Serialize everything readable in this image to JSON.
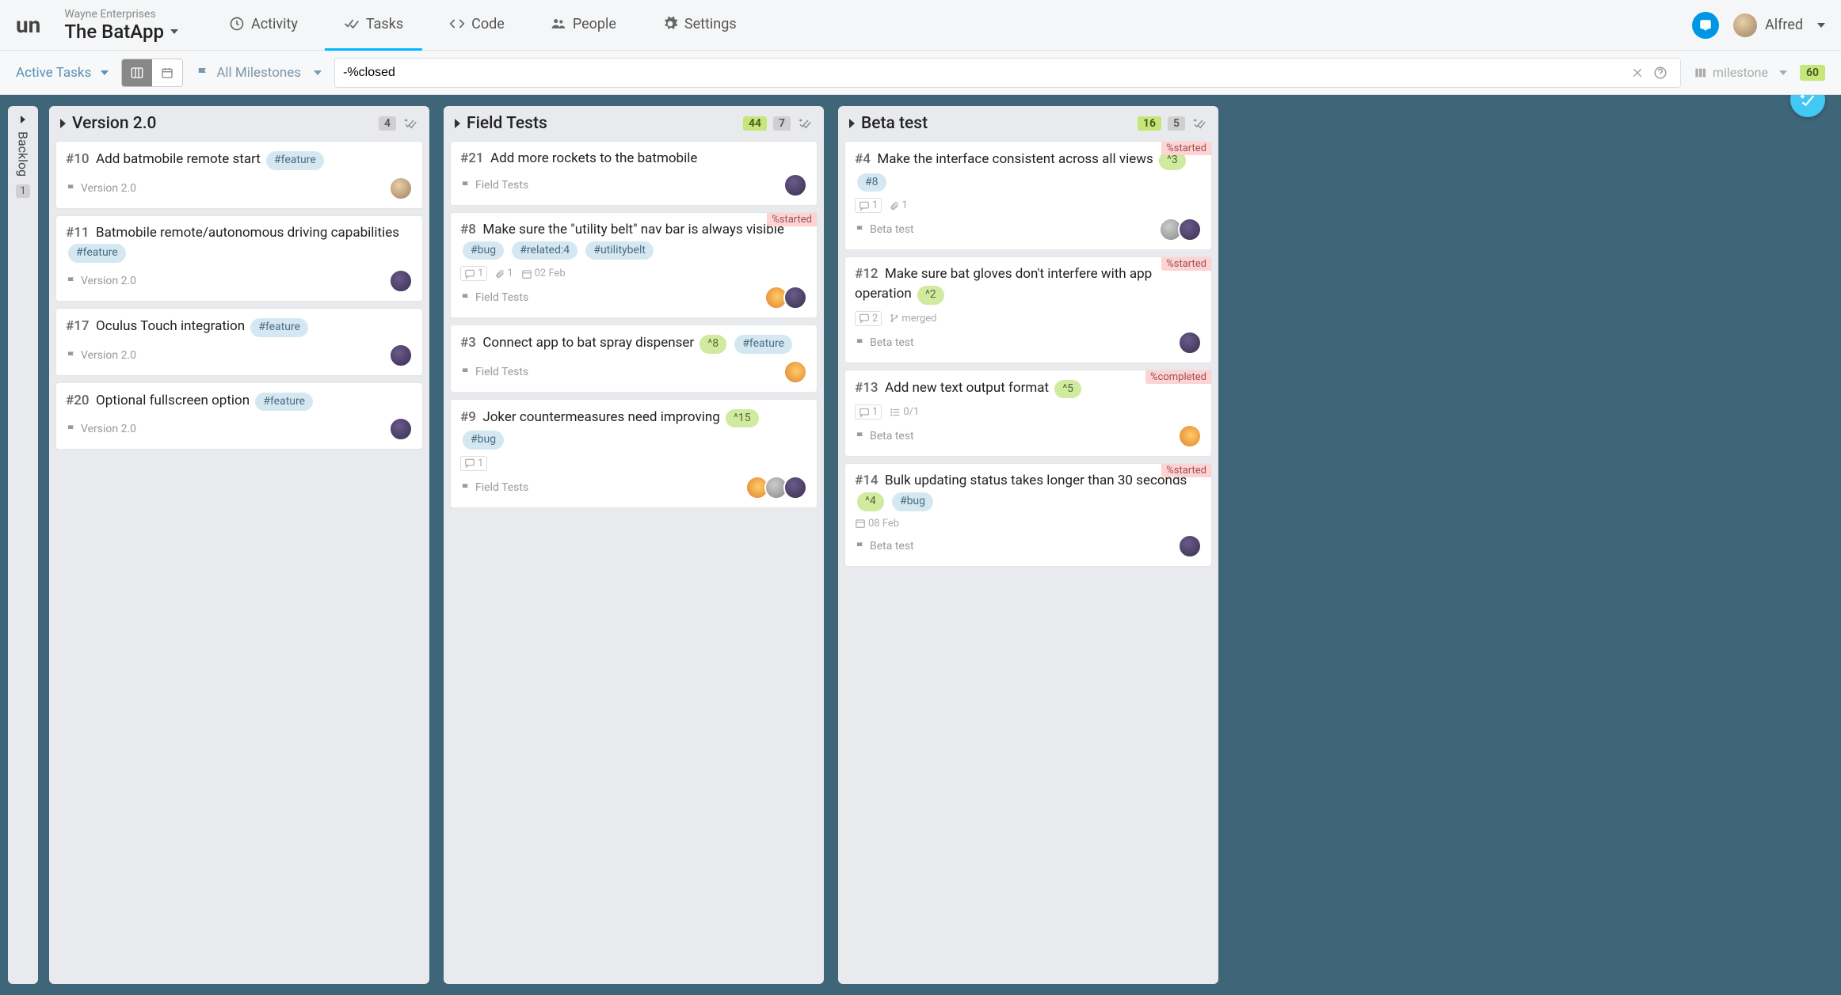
{
  "header": {
    "org": "Wayne Enterprises",
    "project": "The BatApp",
    "nav": {
      "activity": "Activity",
      "tasks": "Tasks",
      "code": "Code",
      "people": "People",
      "settings": "Settings"
    },
    "user": "Alfred"
  },
  "filterbar": {
    "filter": "Active Tasks",
    "milestone_filter": "All Milestones",
    "search_value": "-%closed",
    "group_by": "milestone",
    "total_count": "60"
  },
  "backlog": {
    "label": "Backlog",
    "count": "1"
  },
  "columns": [
    {
      "title": "Version 2.0",
      "count_gray": "4",
      "cards": [
        {
          "num": "#10",
          "title": "Add batmobile remote start",
          "tags": [
            {
              "t": "#feature",
              "k": "feature"
            }
          ],
          "milestone": "Version 2.0",
          "avatars": [
            "face"
          ]
        },
        {
          "num": "#11",
          "title": "Batmobile remote/autonomous driving capabilities",
          "tags": [
            {
              "t": "#feature",
              "k": "feature"
            }
          ],
          "milestone": "Version 2.0",
          "avatars": [
            "purple"
          ]
        },
        {
          "num": "#17",
          "title": "Oculus Touch integration",
          "tags": [
            {
              "t": "#feature",
              "k": "feature"
            }
          ],
          "milestone": "Version 2.0",
          "avatars": [
            "purple"
          ]
        },
        {
          "num": "#20",
          "title": "Optional fullscreen option",
          "tags": [
            {
              "t": "#feature",
              "k": "feature"
            }
          ],
          "milestone": "Version 2.0",
          "avatars": [
            "purple"
          ]
        }
      ]
    },
    {
      "title": "Field Tests",
      "count_green": "44",
      "count_gray": "7",
      "cards": [
        {
          "num": "#21",
          "title": "Add more rockets to the batmobile",
          "tags": [],
          "milestone": "Field Tests",
          "avatars": [
            "purple"
          ]
        },
        {
          "num": "#8",
          "title": "Make sure the \"utility belt\" nav bar is always visible",
          "status": "%started",
          "tags": [
            {
              "t": "#bug",
              "k": "bug"
            },
            {
              "t": "#related:4",
              "k": "related"
            },
            {
              "t": "#utilitybelt",
              "k": "feature"
            }
          ],
          "meta": {
            "comments": "1",
            "attach": "1",
            "date": "02 Feb"
          },
          "milestone": "Field Tests",
          "avatars": [
            "orange",
            "purple"
          ]
        },
        {
          "num": "#3",
          "title": "Connect app to bat spray dispenser",
          "tags": [
            {
              "t": "^8",
              "k": "estimate"
            },
            {
              "t": "#feature",
              "k": "feature"
            }
          ],
          "milestone": "Field Tests",
          "avatars": [
            "orange"
          ]
        },
        {
          "num": "#9",
          "title": "Joker countermeasures need improving",
          "tags": [
            {
              "t": "^15",
              "k": "estimate"
            },
            {
              "t": "#bug",
              "k": "bug"
            }
          ],
          "meta": {
            "comments": "1"
          },
          "milestone": "Field Tests",
          "avatars": [
            "orange",
            "gray",
            "purple"
          ]
        }
      ]
    },
    {
      "title": "Beta test",
      "count_green": "16",
      "count_gray": "5",
      "cards": [
        {
          "num": "#4",
          "title": "Make the interface consistent across all views",
          "status": "%started",
          "tags": [
            {
              "t": "^3",
              "k": "estimate"
            },
            {
              "t": "#8",
              "k": "feature"
            }
          ],
          "meta": {
            "comments": "1",
            "attach": "1"
          },
          "milestone": "Beta test",
          "avatars": [
            "gray",
            "purple"
          ]
        },
        {
          "num": "#12",
          "title": "Make sure bat gloves don't interfere with app operation",
          "status": "%started",
          "tags": [
            {
              "t": "^2",
              "k": "estimate"
            }
          ],
          "meta": {
            "comments": "2",
            "merged": "merged"
          },
          "milestone": "Beta test",
          "avatars": [
            "purple"
          ]
        },
        {
          "num": "#13",
          "title": "Add new text output format",
          "status": "%completed",
          "tags": [
            {
              "t": "^5",
              "k": "estimate"
            }
          ],
          "meta": {
            "comments": "1",
            "checklist": "0/1"
          },
          "milestone": "Beta test",
          "avatars": [
            "orange"
          ]
        },
        {
          "num": "#14",
          "title": "Bulk updating status takes longer than 30 seconds",
          "status": "%started",
          "tags": [
            {
              "t": "^4",
              "k": "estimate"
            },
            {
              "t": "#bug",
              "k": "bug"
            }
          ],
          "meta": {
            "date": "08 Feb"
          },
          "milestone": "Beta test",
          "avatars": [
            "purple"
          ]
        }
      ]
    }
  ]
}
